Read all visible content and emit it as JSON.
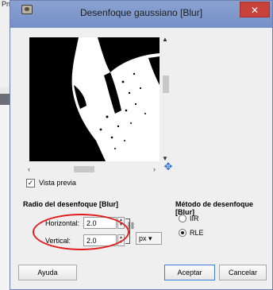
{
  "background": {
    "text": "Pnid"
  },
  "dialog": {
    "title": "Desenfoque gaussiano [Blur]",
    "close_glyph": "✕"
  },
  "preview": {
    "label": "Vista previa",
    "checked": true
  },
  "radius": {
    "section_title": "Radio del desenfoque [Blur]",
    "horizontal_label": "Horizontal:",
    "horizontal_value": "2.0",
    "vertical_label": "Vertical:",
    "vertical_value": "2.0",
    "unit": "px"
  },
  "method": {
    "section_title": "Método de desenfoque [Blur]",
    "options": [
      {
        "label": "IIR",
        "selected": false
      },
      {
        "label": "RLE",
        "selected": true
      }
    ]
  },
  "buttons": {
    "help": "Ayuda",
    "accept": "Aceptar",
    "cancel": "Cancelar"
  },
  "colors": {
    "title_bar": "#7f98cc",
    "close": "#c8413b",
    "highlight": "#e11c1c"
  }
}
